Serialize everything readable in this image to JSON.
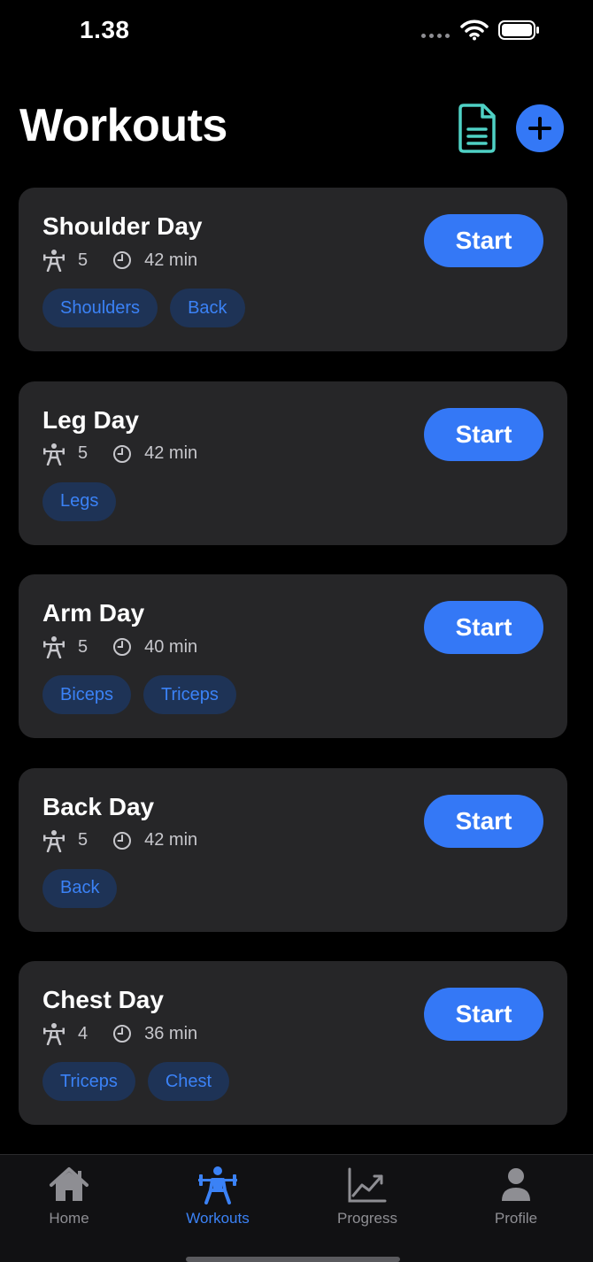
{
  "status_bar": {
    "time": "1.38"
  },
  "header": {
    "title": "Workouts"
  },
  "workouts": [
    {
      "name": "Shoulder Day",
      "exercises": "5",
      "duration": "42 min",
      "start_label": "Start",
      "tags": [
        "Shoulders",
        "Back"
      ]
    },
    {
      "name": "Leg Day",
      "exercises": "5",
      "duration": "42 min",
      "start_label": "Start",
      "tags": [
        "Legs"
      ]
    },
    {
      "name": "Arm Day",
      "exercises": "5",
      "duration": "40 min",
      "start_label": "Start",
      "tags": [
        "Biceps",
        "Triceps"
      ]
    },
    {
      "name": "Back Day",
      "exercises": "5",
      "duration": "42 min",
      "start_label": "Start",
      "tags": [
        "Back"
      ]
    },
    {
      "name": "Chest Day",
      "exercises": "4",
      "duration": "36 min",
      "start_label": "Start",
      "tags": [
        "Triceps",
        "Chest"
      ]
    }
  ],
  "tabs": [
    {
      "label": "Home",
      "icon": "home-icon",
      "active": false
    },
    {
      "label": "Workouts",
      "icon": "weightlifter-icon",
      "active": true
    },
    {
      "label": "Progress",
      "icon": "chart-icon",
      "active": false
    },
    {
      "label": "Profile",
      "icon": "person-icon",
      "active": false
    }
  ],
  "colors": {
    "background": "#000000",
    "card": "#262628",
    "accent": "#3478f6",
    "tag_background": "#1e3356",
    "tag_text": "#3b82f6",
    "doc_icon": "#4fd1c5",
    "muted": "#8e8e93"
  }
}
